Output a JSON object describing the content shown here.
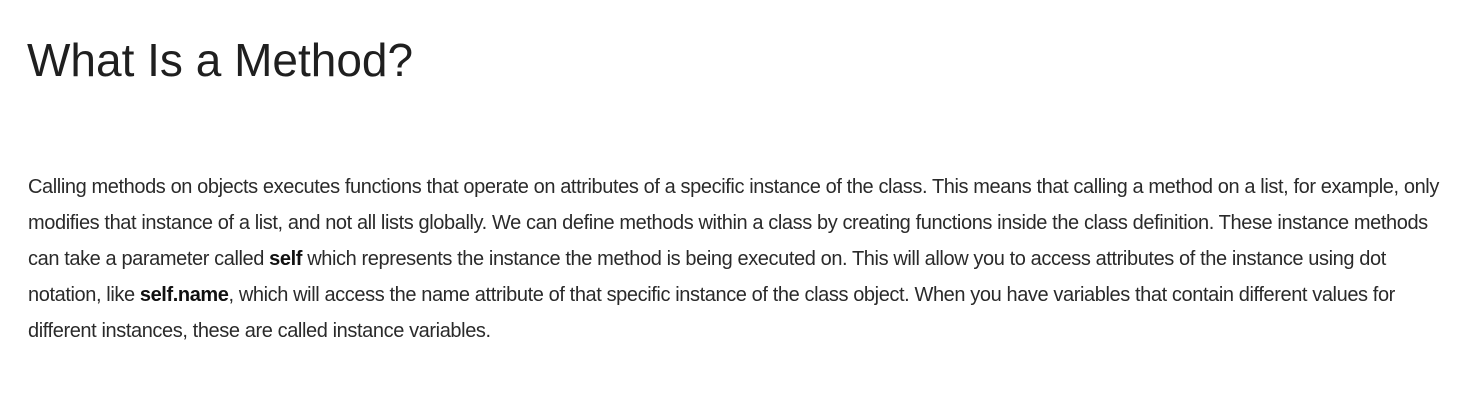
{
  "heading": "What Is a Method?",
  "paragraph": {
    "part1": "Calling methods on objects executes functions that operate on attributes of a specific instance of the class. This means that calling a method on a list, for example, only modifies that instance of a list, and not all lists globally. We can define methods within a class by creating functions inside the class definition. These instance methods can take a parameter called ",
    "bold1": "self",
    "part2": " which represents the instance the method is being executed on. This will allow you to access attributes of the instance using dot notation, like ",
    "bold2": "self.name",
    "part3": ", which will access the name attribute of that specific instance of the class object. When you have variables that contain different values for different instances, these are called instance variables."
  }
}
